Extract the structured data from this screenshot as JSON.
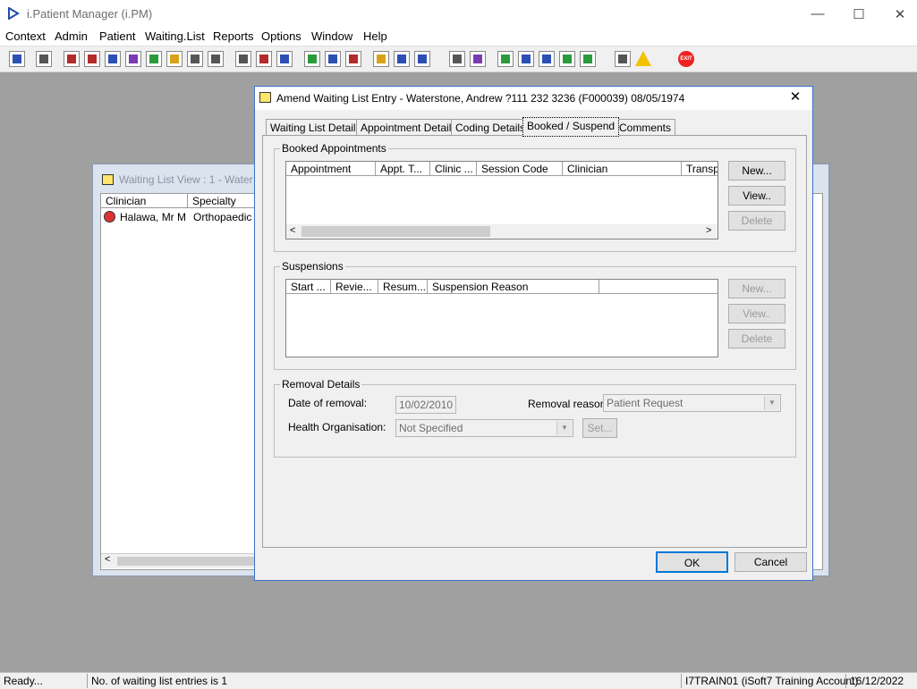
{
  "app": {
    "title": "i.Patient Manager (i.PM)",
    "controls": {
      "minimize": "—",
      "maximize": "☐",
      "close": "✕"
    }
  },
  "menu": [
    "Context",
    "Admin",
    "Patient",
    "Waiting.List",
    "Reports",
    "Options",
    "Window",
    "Help"
  ],
  "toolbar": {
    "exit_label": "EXIT"
  },
  "background_window": {
    "title": "Waiting List View :  1 - Water",
    "columns": [
      "Clinician",
      "Specialty"
    ],
    "rows": [
      {
        "clinician": "Halawa, Mr M",
        "specialty": "Orthopaedic"
      }
    ]
  },
  "dialog": {
    "title": "Amend Waiting List Entry - Waterstone, Andrew ?111 232 3236 (F000039) 08/05/1974",
    "close": "✕",
    "tabs": [
      "Waiting List Details",
      "Appointment Details",
      "Coding Details",
      "Booked / Suspend",
      "Comments"
    ],
    "active_tab": "Booked / Suspend",
    "booked": {
      "label": "Booked Appointments",
      "columns": [
        "Appointment",
        "Appt. T...",
        "Clinic ...",
        "Session Code",
        "Clinician",
        "Transp"
      ],
      "buttons": {
        "new": "New...",
        "view": "View..",
        "delete": "Delete"
      },
      "scroll_left": "<",
      "scroll_right": ">"
    },
    "suspensions": {
      "label": "Suspensions",
      "columns": [
        "Start ...",
        "Revie...",
        "Resum...",
        "Suspension Reason",
        ""
      ],
      "buttons": {
        "new": "New...",
        "view": "View..",
        "delete": "Delete"
      }
    },
    "removal": {
      "label": "Removal Details",
      "date_label": "Date of removal:",
      "date_value": "10/02/2010",
      "reason_label": "Removal reason:",
      "reason_value": "Patient Request",
      "org_label": "Health Organisation:",
      "org_value": "Not Specified",
      "set_button": "Set..."
    },
    "ok": "OK",
    "cancel": "Cancel"
  },
  "status": {
    "ready": "Ready...",
    "entries": "No. of waiting list entries is 1",
    "account": "I7TRAIN01 (iSoft7 Training Account)",
    "date": "16/12/2022"
  },
  "colors": {
    "dialog_border": "#3a73c9",
    "desktop": "#a0a0a0"
  }
}
